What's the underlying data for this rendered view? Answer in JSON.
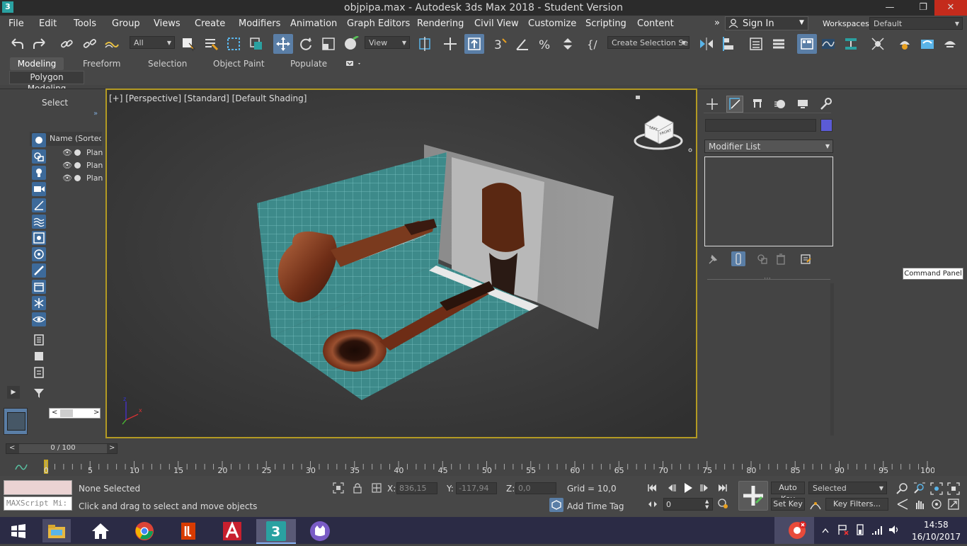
{
  "window": {
    "title": "objpipa.max - Autodesk 3ds Max 2018 - Student Version",
    "app_icon": "3",
    "minimize": "—",
    "restore": "❐",
    "close": "✕"
  },
  "menubar": {
    "items": [
      "File",
      "Edit",
      "Tools",
      "Group",
      "Views",
      "Create",
      "Modifiers",
      "Animation",
      "Graph Editors",
      "Rendering",
      "Civil View",
      "Customize",
      "Scripting",
      "Content"
    ],
    "overflow": "»",
    "sign_in": "Sign In",
    "workspaces_label": "Workspaces:",
    "workspace_value": "Default"
  },
  "toolbar": {
    "selection_filter": "All",
    "ref_coord": "View",
    "selection_set_placeholder": "Create Selection Se"
  },
  "ribbon": {
    "tabs": [
      "Modeling",
      "Freeform",
      "Selection",
      "Object Paint",
      "Populate"
    ],
    "panel_label": "Polygon Modeling"
  },
  "scene_explorer": {
    "title": "Select",
    "column_header": "Name (Sorted A",
    "rows": [
      "Plan",
      "Plan",
      "Plan"
    ]
  },
  "viewport": {
    "label": "[+] [Perspective] [Standard] [Default Shading]",
    "viewcube_left": "LEFT",
    "viewcube_front": "FRONT",
    "axis_x": "x",
    "axis_z": "z"
  },
  "command_panel": {
    "modifier_list": "Modifier List",
    "object_color": "#5b5bd6",
    "tooltip": "Command Panel"
  },
  "timeline": {
    "frame": "0 / 100",
    "prev": "<",
    "next": ">",
    "ticks": [
      "0",
      "5",
      "10",
      "15",
      "20",
      "25",
      "30",
      "35",
      "40",
      "45",
      "50",
      "55",
      "60",
      "65",
      "70",
      "75",
      "80",
      "85",
      "90",
      "95",
      "100"
    ]
  },
  "status": {
    "maxscript_placeholder": "MAXScript Mi:",
    "selection": "None Selected",
    "prompt": "Click and drag to select and move objects",
    "x_label": "X:",
    "x_value": "836,15",
    "y_label": "Y:",
    "y_value": "-117,94",
    "z_label": "Z:",
    "z_value": "0,0",
    "grid": "Grid = 10,0",
    "add_time_tag": "Add Time Tag",
    "auto_key": "Auto Key",
    "set_key": "Set Key",
    "key_mode": "Selected",
    "key_filters": "Key Filters...",
    "current_frame": "0"
  },
  "taskbar": {
    "time": "14:58",
    "date": "16/10/2017"
  }
}
